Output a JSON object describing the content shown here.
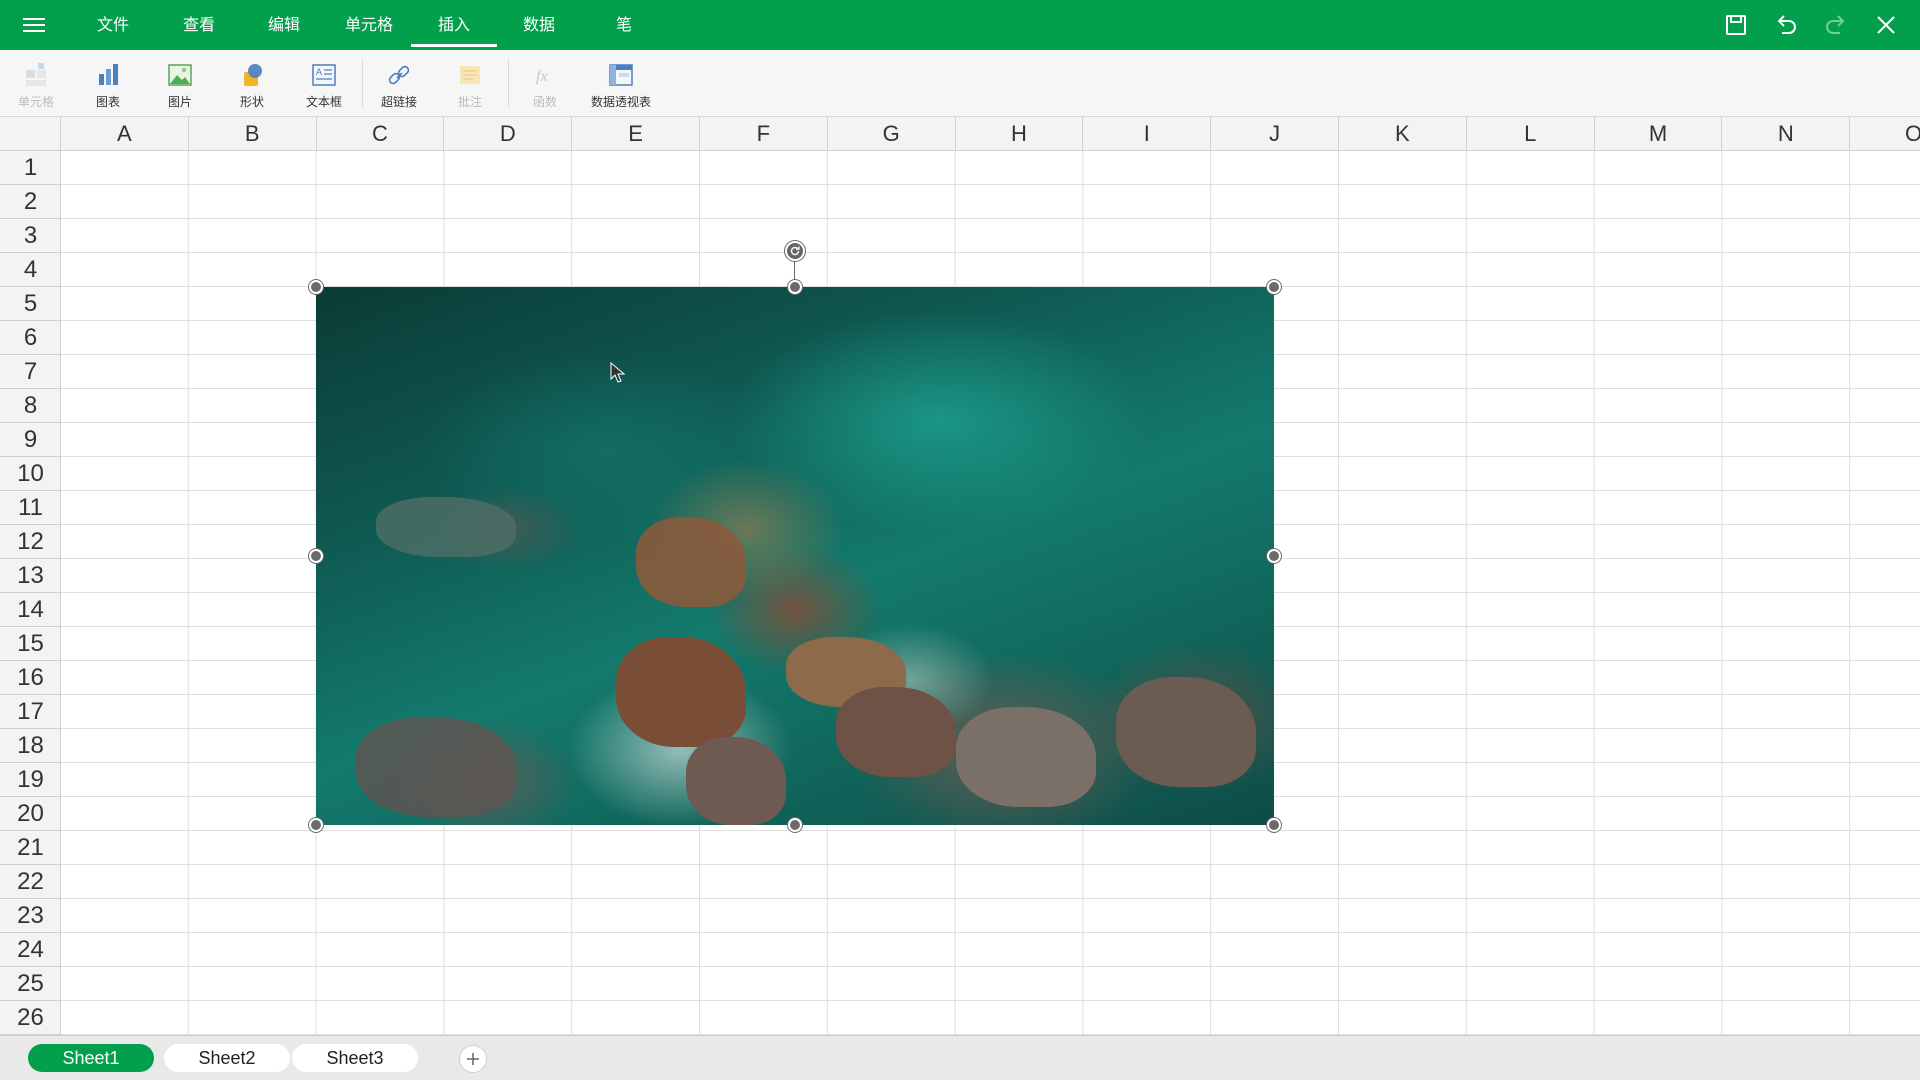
{
  "menu": {
    "icon": "hamburger-menu-icon"
  },
  "tabs": [
    {
      "label": "文件"
    },
    {
      "label": "查看"
    },
    {
      "label": "编辑"
    },
    {
      "label": "单元格"
    },
    {
      "label": "插入",
      "active": true
    },
    {
      "label": "数据"
    },
    {
      "label": "笔"
    }
  ],
  "top_actions": {
    "save_icon": "save-icon",
    "undo_icon": "undo-icon",
    "redo_icon": "redo-icon",
    "close_icon": "close-icon"
  },
  "ribbon": {
    "items": [
      {
        "label": "单元格",
        "icon": "cell-insert-icon",
        "enabled": false
      },
      {
        "label": "图表",
        "icon": "chart-icon",
        "enabled": true
      },
      {
        "label": "图片",
        "icon": "picture-icon",
        "enabled": true
      },
      {
        "label": "形状",
        "icon": "shape-icon",
        "enabled": true
      },
      {
        "label": "文本框",
        "icon": "textbox-icon",
        "enabled": true
      },
      {
        "label": "超链接",
        "icon": "hyperlink-icon",
        "enabled": true
      },
      {
        "label": "批注",
        "icon": "comment-icon",
        "enabled": false
      },
      {
        "label": "函数",
        "icon": "function-icon",
        "enabled": false
      },
      {
        "label": "数据透视表",
        "icon": "pivot-table-icon",
        "enabled": true
      }
    ]
  },
  "grid": {
    "columns": [
      "A",
      "B",
      "C",
      "D",
      "E",
      "F",
      "G",
      "H",
      "I",
      "J",
      "K",
      "L",
      "M",
      "N",
      "O"
    ],
    "rows": [
      "1",
      "2",
      "3",
      "4",
      "5",
      "6",
      "7",
      "8",
      "9",
      "10",
      "11",
      "12",
      "13",
      "14",
      "15",
      "16",
      "17",
      "18",
      "19",
      "20",
      "21",
      "22",
      "23",
      "24",
      "25",
      "26"
    ]
  },
  "picture": {
    "content": "aerial view of turquoise sea water and coastal rocks",
    "selected": true
  },
  "sheets": [
    {
      "label": "Sheet1",
      "active": true
    },
    {
      "label": "Sheet2",
      "active": false
    },
    {
      "label": "Sheet3",
      "active": false
    }
  ],
  "colors": {
    "brand_green": "#02a04c",
    "ribbon_bg": "#f6f6f6",
    "header_bg": "#f3f3f3"
  }
}
